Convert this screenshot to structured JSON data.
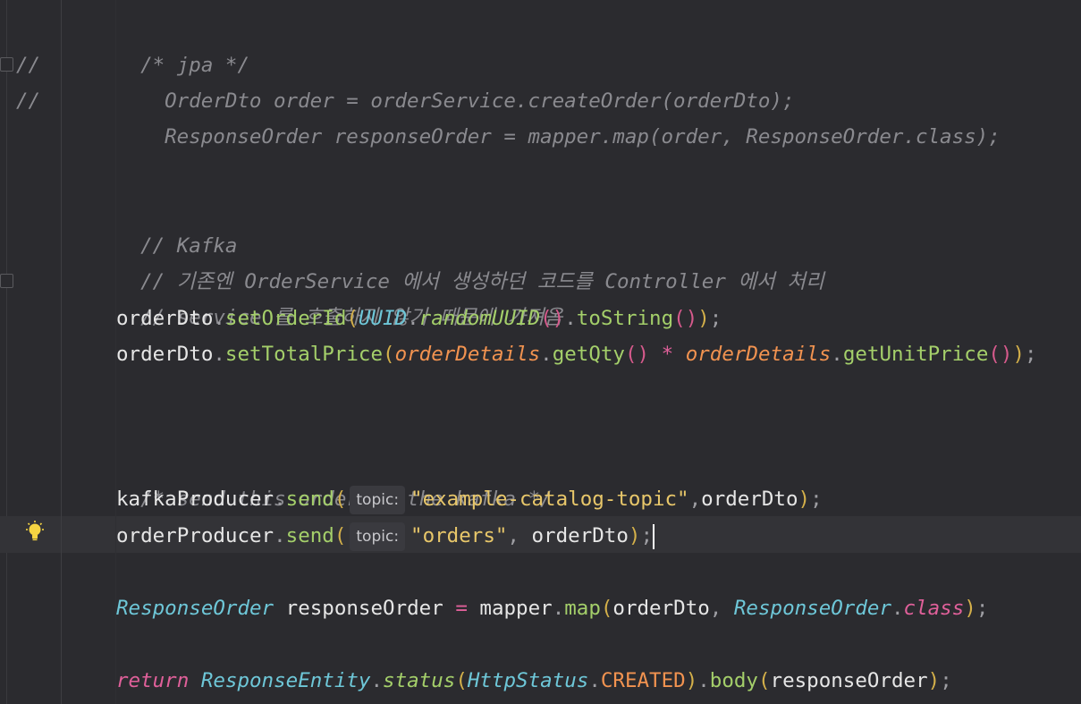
{
  "editor": {
    "gutter_markers": [
      "//",
      "//"
    ],
    "icons": {
      "intention": "lightbulb-icon"
    },
    "param_hint_label": "topic:",
    "lines": {
      "l1": "/* jpa */",
      "l2": "OrderDto order = orderService.createOrder(orderDto);",
      "l3": "ResponseOrder responseOrder = mapper.map(order, ResponseOrder.class);",
      "l4": "// Kafka",
      "l5": "// 기존엔 OrderService 에서 생성하던 코드를 Controller 에서 처리",
      "l6": "// service 를 호출하지 않기 때문에 가져옴",
      "l7": {
        "a": "orderDto",
        "b": ".",
        "c": "setOrderId",
        "d": "(",
        "e": "UUID",
        "f": ".",
        "g": "randomUUID",
        "h": "()",
        "i": ".",
        "j": "toString",
        "k": "()",
        "l": ")",
        "m": ";"
      },
      "l8": {
        "a": "orderDto",
        "b": ".",
        "c": "setTotalPrice",
        "d": "(",
        "e": "orderDetails",
        "f": ".",
        "g": "getQty",
        "h": "()",
        "i": " * ",
        "j": "orderDetails",
        "k": ".",
        "l": "getUnitPrice",
        "m": "()",
        "n": ")",
        "o": ";"
      },
      "l9": "/* send this order to the kafka */",
      "l10": {
        "a": "kafkaProducer",
        "b": ".",
        "c": "send",
        "d": "(",
        "e": "\"example-catalog-topic\"",
        "f": ",",
        "g": "orderDto",
        "h": ")",
        "i": ";"
      },
      "l11": {
        "a": "orderProducer",
        "b": ".",
        "c": "send",
        "d": "(",
        "e": "\"orders\"",
        "f": ", ",
        "g": "orderDto",
        "h": ")",
        "i": ";"
      },
      "l12": {
        "a": "ResponseOrder",
        "b": " responseOrder ",
        "c": "=",
        "d": " mapper",
        "e": ".",
        "f": "map",
        "g": "(",
        "h": "orderDto",
        "i": ", ",
        "j": "ResponseOrder",
        "k": ".",
        "l": "class",
        "m": ")",
        "n": ";"
      },
      "l13": {
        "a": "return",
        "b": " ",
        "c": "ResponseEntity",
        "d": ".",
        "e": "status",
        "f": "(",
        "g": "HttpStatus",
        "h": ".",
        "i": "CREATED",
        "j": ")",
        "k": ".",
        "l": "body",
        "m": "(",
        "n": "responseOrder",
        "o": ")",
        "p": ";"
      }
    }
  }
}
